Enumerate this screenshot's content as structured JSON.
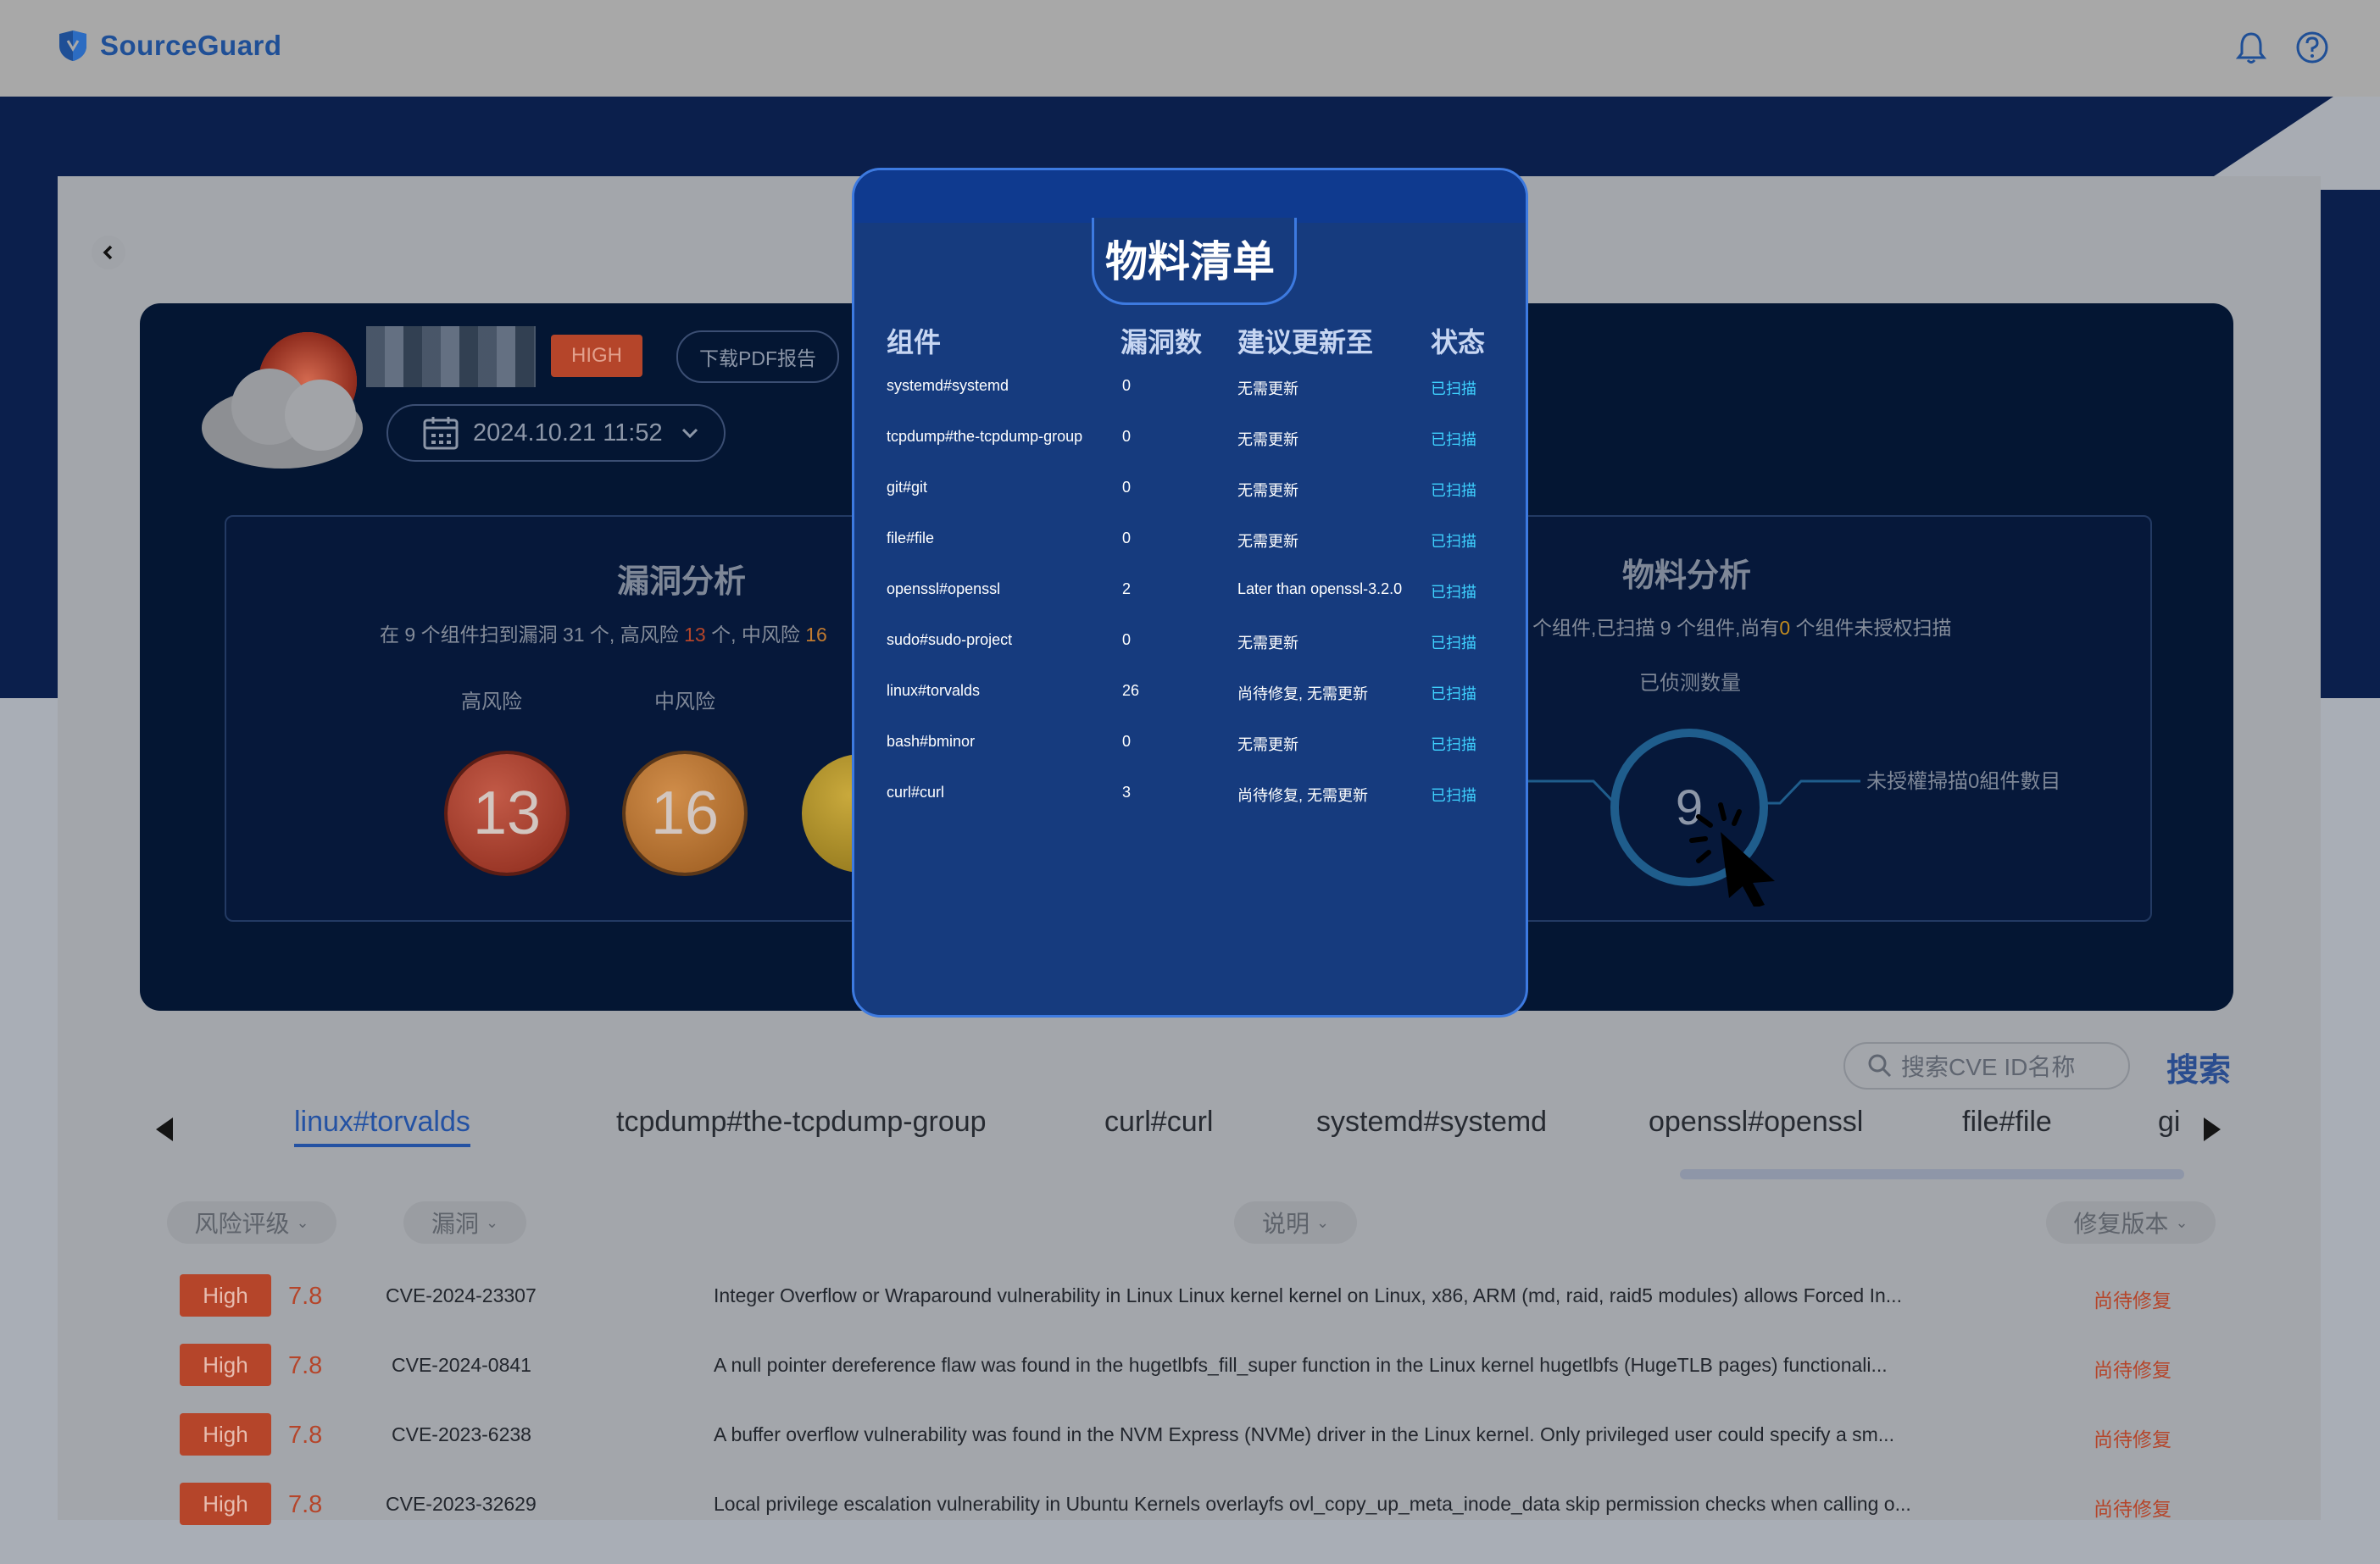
{
  "app": {
    "name": "SourceGuard"
  },
  "header": {
    "bell": "bell-icon",
    "help": "help-icon"
  },
  "project": {
    "badge": "HIGH",
    "pdf_label": "下载PDF报告",
    "date": "2024.10.21 11:52"
  },
  "vuln_analysis": {
    "title": "漏洞分析",
    "summary": {
      "part1": "在 9 个组件扫到漏洞 31 个, 高风险 ",
      "high": "13",
      "part2": " 个, 中风险 ",
      "mid": "16"
    },
    "levels": [
      {
        "label": "高风险",
        "value": "13"
      },
      {
        "label": "中风险",
        "value": "16"
      }
    ]
  },
  "sbom_analysis": {
    "title": "物料分析",
    "summary": {
      "part1": "个组件,已扫描 9 个组件,尚有",
      "unauth": "0",
      "part2": " 个组件未授权扫描"
    },
    "detected_label": "已侦测数量",
    "detected_value": "9",
    "unauth_label": "未授權掃描0組件數目"
  },
  "search": {
    "placeholder": "搜索CVE ID名称",
    "button": "搜索"
  },
  "tabs": [
    "linux#torvalds",
    "tcpdump#the-tcpdump-group",
    "curl#curl",
    "systemd#systemd",
    "openssl#openssl",
    "file#file",
    "gi"
  ],
  "filters": {
    "risk": "风险评级",
    "vuln": "漏洞",
    "desc": "说明",
    "fix": "修复版本"
  },
  "vulns": [
    {
      "severity": "High",
      "score": "7.8",
      "cve": "CVE-2024-23307",
      "desc": "Integer Overflow or Wraparound vulnerability in Linux Linux kernel kernel on Linux, x86, ARM (md, raid, raid5 modules) allows Forced In...",
      "fix": "尚待修复"
    },
    {
      "severity": "High",
      "score": "7.8",
      "cve": "CVE-2024-0841",
      "desc": "A null pointer dereference flaw was found in the hugetlbfs_fill_super function in the Linux kernel hugetlbfs (HugeTLB pages) functionali...",
      "fix": "尚待修复"
    },
    {
      "severity": "High",
      "score": "7.8",
      "cve": "CVE-2023-6238",
      "desc": "A buffer overflow vulnerability was found in the NVM Express (NVMe) driver in the Linux kernel. Only privileged user could specify a sm...",
      "fix": "尚待修复"
    },
    {
      "severity": "High",
      "score": "7.8",
      "cve": "CVE-2023-32629",
      "desc": "Local privilege escalation vulnerability in Ubuntu Kernels overlayfs ovl_copy_up_meta_inode_data skip permission checks when calling o...",
      "fix": "尚待修复"
    }
  ],
  "modal": {
    "title": "物料清单",
    "headers": {
      "component": "组件",
      "count": "漏洞数",
      "update": "建议更新至",
      "status": "状态"
    },
    "rows": [
      {
        "component": "systemd#systemd",
        "count": "0",
        "update": "无需更新",
        "status": "已扫描"
      },
      {
        "component": "tcpdump#the-tcpdump-group",
        "count": "0",
        "update": "无需更新",
        "status": "已扫描"
      },
      {
        "component": "git#git",
        "count": "0",
        "update": "无需更新",
        "status": "已扫描"
      },
      {
        "component": "file#file",
        "count": "0",
        "update": "无需更新",
        "status": "已扫描"
      },
      {
        "component": "openssl#openssl",
        "count": "2",
        "update": "Later than openssl-3.2.0",
        "status": "已扫描"
      },
      {
        "component": "sudo#sudo-project",
        "count": "0",
        "update": "无需更新",
        "status": "已扫描"
      },
      {
        "component": "linux#torvalds",
        "count": "26",
        "update": "尚待修复, 无需更新",
        "status": "已扫描"
      },
      {
        "component": "bash#bminor",
        "count": "0",
        "update": "无需更新",
        "status": "已扫描"
      },
      {
        "component": "curl#curl",
        "count": "3",
        "update": "尚待修复, 无需更新",
        "status": "已扫描"
      }
    ]
  }
}
